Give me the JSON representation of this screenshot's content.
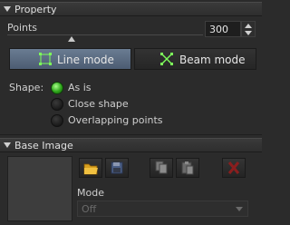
{
  "property_panel": {
    "title": "Property",
    "points_label": "Points",
    "points_value": "300",
    "points_slider_fraction": 0.33,
    "line_mode_label": "Line mode",
    "beam_mode_label": "Beam mode",
    "shape_label": "Shape:",
    "shape_options": [
      {
        "label": "As is",
        "selected": true
      },
      {
        "label": "Close shape",
        "selected": false
      },
      {
        "label": "Overlapping points",
        "selected": false
      }
    ]
  },
  "base_image_panel": {
    "title": "Base Image",
    "tools": [
      "open-folder-icon",
      "save-icon",
      "copy-icon",
      "paste-icon",
      "delete-icon"
    ],
    "mode_label": "Mode",
    "mode_value": "Off"
  },
  "colors": {
    "active_button": "#5a6b82",
    "radio_on": "#3cc820",
    "delete_icon": "#8a1e1e"
  }
}
